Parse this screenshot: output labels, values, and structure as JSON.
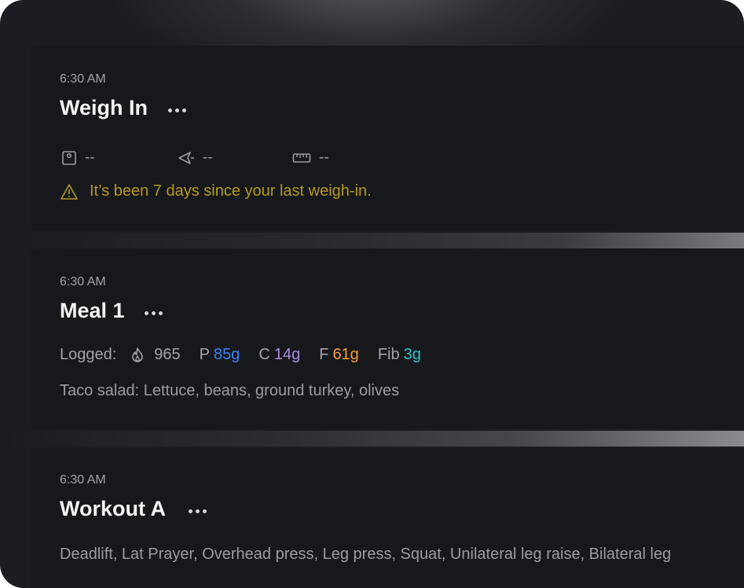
{
  "cards": {
    "weigh": {
      "time": "6:30 AM",
      "title": "Weigh In",
      "metrics": {
        "weight": {
          "icon": "scale-icon",
          "value": "--"
        },
        "bodyfat": {
          "icon": "caliper-icon",
          "value": "--"
        },
        "measure": {
          "icon": "ruler-icon",
          "value": "--"
        }
      },
      "warning": {
        "icon": "warning-icon",
        "text": "It’s been 7 days since your last weigh-in."
      }
    },
    "meal": {
      "time": "6:30 AM",
      "title": "Meal 1",
      "logged_label": "Logged:",
      "calories": {
        "icon": "flame-icon",
        "value": "965"
      },
      "protein": {
        "label": "P",
        "value": "85g",
        "color": "#3b82f6"
      },
      "carbs": {
        "label": "C",
        "value": "14g",
        "color": "#a78bdb"
      },
      "fat": {
        "label": "F",
        "value": "61g",
        "color": "#f59e34"
      },
      "fiber": {
        "label": "Fib",
        "value": "3g",
        "color": "#2cc4c9"
      },
      "description": "Taco salad: Lettuce, beans, ground turkey, olives"
    },
    "workout": {
      "time": "6:30 AM",
      "title": "Workout A",
      "description": "Deadlift, Lat Prayer, Overhead press, Leg press, Squat, Unilateral leg raise, Bilateral leg"
    }
  },
  "colors": {
    "warning": "#b39a22",
    "card_bg": "#17181b"
  }
}
